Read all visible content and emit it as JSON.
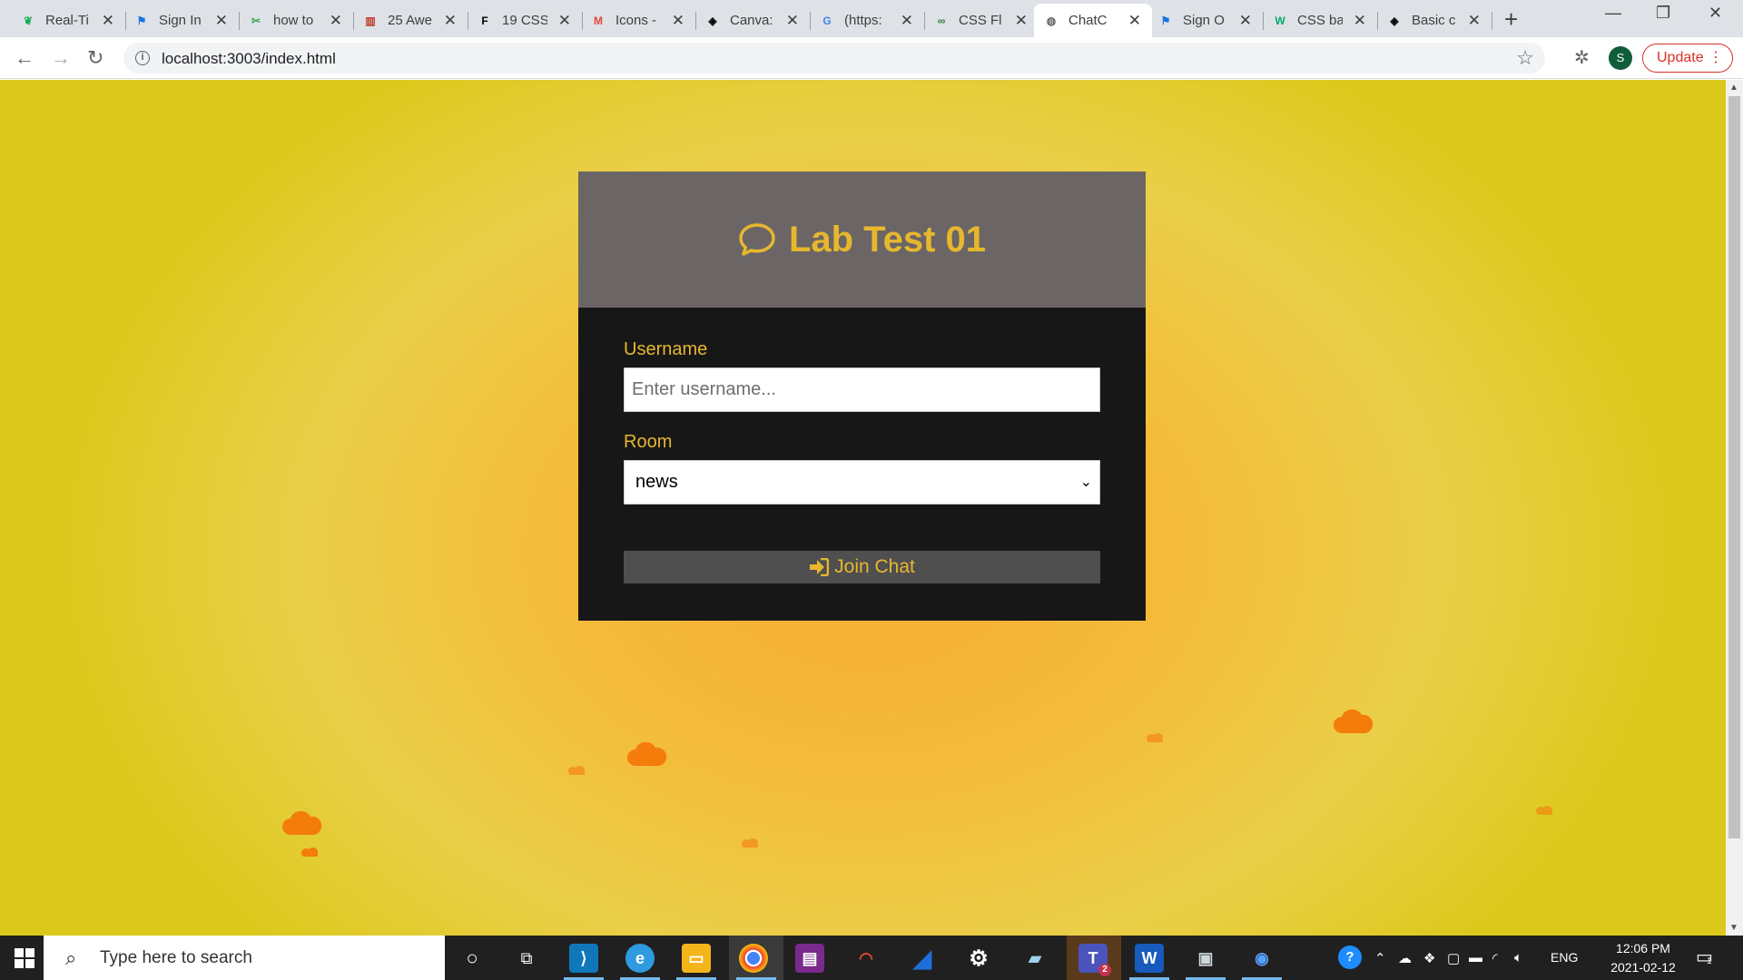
{
  "browser": {
    "tabs": [
      {
        "label": "Real-Ti",
        "icon": "leaf-icon",
        "color": "#13aa52"
      },
      {
        "label": "Sign In",
        "icon": "flag-icon",
        "color": "#1a73e8"
      },
      {
        "label": "how to",
        "icon": "scissors-icon",
        "color": "#34a853"
      },
      {
        "label": "25 Awe",
        "icon": "chart-icon",
        "color": "#c0392b"
      },
      {
        "label": "19 CSS",
        "icon": "f-logo-icon",
        "color": "#000000"
      },
      {
        "label": "Icons -",
        "icon": "m-logo-icon",
        "color": "#e8453c"
      },
      {
        "label": "Canva:",
        "icon": "codepen-icon",
        "color": "#000000"
      },
      {
        "label": "(https:",
        "icon": "google-icon",
        "color": "#4285f4"
      },
      {
        "label": "CSS Fl",
        "icon": "infinity-icon",
        "color": "#2e7d32"
      },
      {
        "label": "ChatC",
        "icon": "globe-icon",
        "color": "#5f6368"
      },
      {
        "label": "Sign O",
        "icon": "flag-icon",
        "color": "#1a73e8"
      },
      {
        "label": "CSS ba",
        "icon": "w-logo-icon",
        "color": "#04aa6d"
      },
      {
        "label": "Basic c",
        "icon": "codepen-icon",
        "color": "#000000"
      }
    ],
    "close_glyph": "✕",
    "new_tab": "+",
    "url": "localhost:3003/index.html",
    "profile_initial": "S",
    "update_label": "Update"
  },
  "page": {
    "title": "Lab Test 01",
    "username_label": "Username",
    "username_placeholder": "Enter username...",
    "room_label": "Room",
    "room_selected": "news",
    "join_label": "Join Chat",
    "accent_color": "#e7b72e",
    "cloud_color": "#f47c0b"
  },
  "taskbar": {
    "search_placeholder": "Type here to search",
    "language": "ENG",
    "time": "12:06 PM",
    "date": "2021-02-12",
    "teams_badge": "2",
    "notification_count": "1"
  }
}
